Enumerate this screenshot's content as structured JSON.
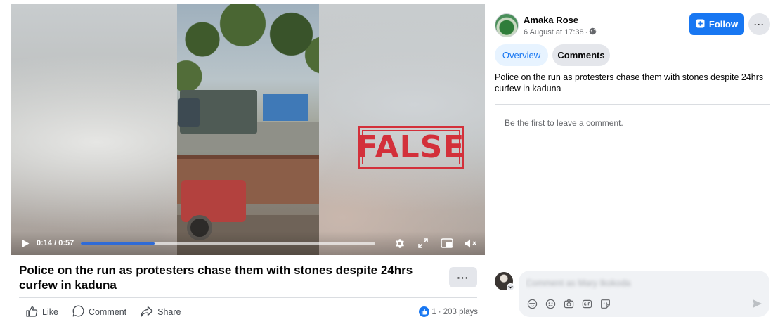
{
  "video": {
    "time_current": "0:14",
    "time_total": "0:57",
    "progress": 0.25,
    "stamp_text": "FALSE",
    "stamp_color": "#d3303a",
    "progress_color": "#2f6bd6",
    "icons": [
      "play-icon",
      "settings-icon",
      "expand-icon",
      "miniplayer-icon",
      "volume-icon"
    ]
  },
  "post": {
    "title": "Police on the run as protesters chase them with stones despite 24hrs curfew in kaduna",
    "more": "···",
    "actions": {
      "like": "Like",
      "comment": "Comment",
      "share": "Share"
    },
    "reaction_count": "1",
    "plays": "· 203 plays"
  },
  "sidebar": {
    "author": "Amaka Rose",
    "date": "6 August at 17:38",
    "meta_separator": "·",
    "follow_label": "Follow",
    "more": "···",
    "tabs": {
      "overview": "Overview",
      "comments": "Comments"
    },
    "description": "Police on the run as protesters chase them with stones despite 24hrs curfew in kaduna",
    "empty_comments": "Be the first to leave a comment.",
    "comment_placeholder": "Comment as Mary Ikokoda",
    "accent_color": "#1877f2"
  }
}
